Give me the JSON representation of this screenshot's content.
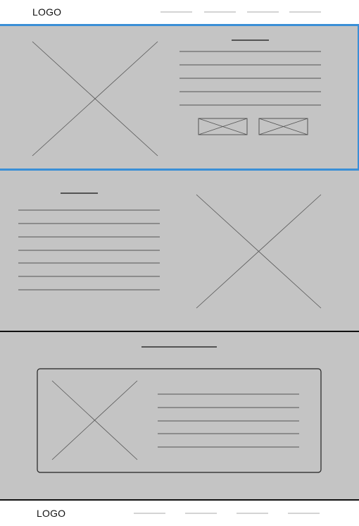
{
  "header": {
    "logo": "LOGO"
  },
  "footer": {
    "logo": "LOGO"
  },
  "colors": {
    "section_bg": "#c4c4c4",
    "accent_border": "#3a8fd6",
    "placeholder_stroke": "#555555"
  }
}
